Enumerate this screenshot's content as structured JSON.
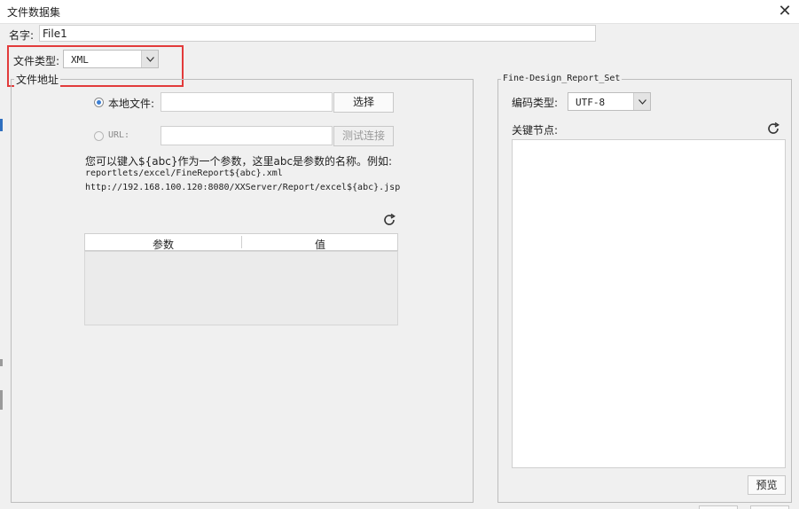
{
  "window": {
    "title": "文件数据集",
    "close_glyph": "✕"
  },
  "name_field": {
    "label": "名字:",
    "value": "File1"
  },
  "file_type": {
    "label": "文件类型:",
    "selected": "XML"
  },
  "file_address": {
    "legend": "文件地址",
    "local_file": {
      "label": "本地文件:",
      "value": "",
      "button": "选择",
      "selected": true
    },
    "url": {
      "label": "URL:",
      "value": "",
      "button": "测试连接",
      "selected": false
    },
    "hint": {
      "line1": "您可以键入${abc}作为一个参数，这里abc是参数的名称。例如:",
      "line2": "reportlets/excel/FineReport${abc}.xml",
      "line3": "http://192.168.100.120:8080/XXServer/Report/excel${abc}.jsp"
    },
    "table": {
      "columns": [
        "参数",
        "值"
      ],
      "rows": []
    }
  },
  "design_panel": {
    "legend": "Fine-Design_Report_Set",
    "encoding": {
      "label": "编码类型:",
      "selected": "UTF-8"
    },
    "key_nodes_label": "关键节点:",
    "preview_button": "预览"
  },
  "icons": {
    "refresh": "refresh-icon",
    "dropdown": "chevron-down-icon",
    "close": "close-icon"
  },
  "colors": {
    "highlight_box": "#e23b3b",
    "radio_selected": "#3c7fd3"
  }
}
